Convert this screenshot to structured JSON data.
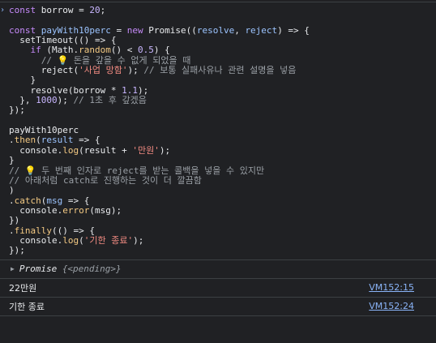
{
  "console": {
    "input_code_lines": [
      "const borrow = 20;",
      "",
      "const payWith10perc = new Promise((resolve, reject) => {",
      "  setTimeout(() => {",
      "    if (Math.random() < 0.5) {",
      "      // 💡 돈을 갚을 수 없게 되었을 때",
      "      reject('사업 망함'); // 보통 실패사유나 관련 설명을 넣음",
      "    }",
      "    resolve(borrow * 1.1);",
      "  }, 1000); // 1초 후 갚겠음",
      "});",
      "",
      "payWith10perc",
      ".then(result => {",
      "  console.log(result + '만원');",
      "}",
      "// 💡 두 번째 인자로 reject를 받는 콜백을 넣을 수 있지만",
      "// 아래처럼 catch로 진행하는 것이 더 깔끔함",
      ")",
      ".catch(msg => {",
      "  console.error(msg);",
      "})",
      ".finally(() => {",
      "  console.log('기한 종료');",
      "});"
    ],
    "result": {
      "label": "Promise",
      "state": "{<pending>}"
    },
    "logs": [
      {
        "text": "22만원",
        "source": "VM152:15"
      },
      {
        "text": "기한 종료",
        "source": "VM152:24"
      }
    ],
    "prompt_symbol": "›",
    "expand_symbol": "▶"
  }
}
